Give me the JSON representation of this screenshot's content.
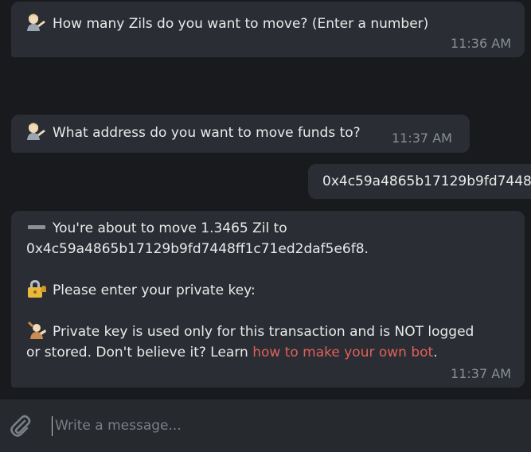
{
  "messages": [
    {
      "direction": "incoming",
      "emoji": "person-tipping-hand",
      "text": "How many Zils do you want to move? (Enter a number)",
      "time": "11:36 AM"
    },
    {
      "direction": "incoming",
      "emoji": "person-tipping-hand",
      "text": "What address do you want to move funds to?",
      "time": "11:37 AM"
    },
    {
      "direction": "outgoing",
      "text": "0x4c59a4865b17129b9fd7448"
    },
    {
      "direction": "incoming",
      "line1": "You're about to move 1.3465 Zil to",
      "line2": "0x4c59a4865b17129b9fd7448ff1c71ed2daf5e6f8.",
      "line3": "Please enter your private key:",
      "line4": "Private key is used only for this transaction and is NOT logged",
      "line5_prefix": "or stored. Don't believe it? Learn ",
      "link": "how to make your own bot",
      "line5_suffix": ".",
      "time": "11:37 AM"
    }
  ],
  "composer": {
    "placeholder": "Write a message..."
  },
  "colors": {
    "background": "#181a1e",
    "bubble": "#2a2d33",
    "text": "#eaeaea",
    "time": "#8a8f96",
    "link": "#e0605a",
    "composer": "#26292e"
  }
}
